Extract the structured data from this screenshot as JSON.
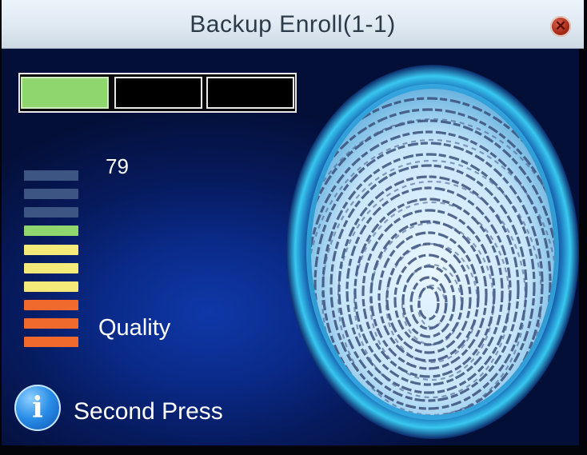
{
  "window": {
    "title": "Backup Enroll(1-1)",
    "close_symbol": "✕"
  },
  "enroll_progress": {
    "total_presses": 3,
    "completed_presses": 1,
    "done_color": "#8fd66e"
  },
  "quality": {
    "score": "79",
    "label": "Quality",
    "meter_levels": 10,
    "meter_lit_levels": 7,
    "colors": {
      "off": "#3c5582",
      "good": "#8fd66e",
      "medium": "#f3ea7a",
      "low": "#ef6a2c"
    }
  },
  "status": {
    "icon": "info-icon",
    "text": "Second Press"
  },
  "fingerprint": {
    "icon": "fingerprint-scan-icon",
    "ring_color": "#38c8f0"
  }
}
